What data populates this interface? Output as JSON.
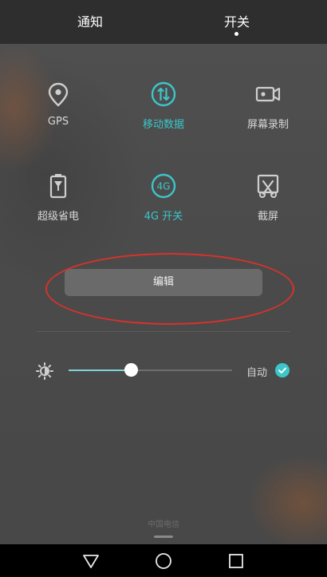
{
  "header": {
    "tabs": [
      {
        "label": "通知"
      },
      {
        "label": "开关",
        "selected": true
      }
    ]
  },
  "toggles": [
    {
      "label": "GPS",
      "icon": "location-pin-icon",
      "active": false
    },
    {
      "label": "移动数据",
      "icon": "mobile-data-icon",
      "active": true
    },
    {
      "label": "屏幕录制",
      "icon": "screen-record-icon",
      "active": false
    },
    {
      "label": "超级省电",
      "icon": "battery-saver-icon",
      "active": false
    },
    {
      "label": "4G 开关",
      "icon": "lte-4g-icon",
      "active": true,
      "badge": "4G"
    },
    {
      "label": "截屏",
      "icon": "screenshot-icon",
      "active": false
    }
  ],
  "edit_button": {
    "label": "编辑"
  },
  "brightness": {
    "level": 0.38,
    "auto_label": "自动",
    "auto_checked": true
  },
  "footer": {
    "carrier": "中国电信"
  },
  "colors": {
    "accent": "#3cc6c9",
    "annotation": "#d8322b",
    "header_bg": "#2e2e2e"
  }
}
